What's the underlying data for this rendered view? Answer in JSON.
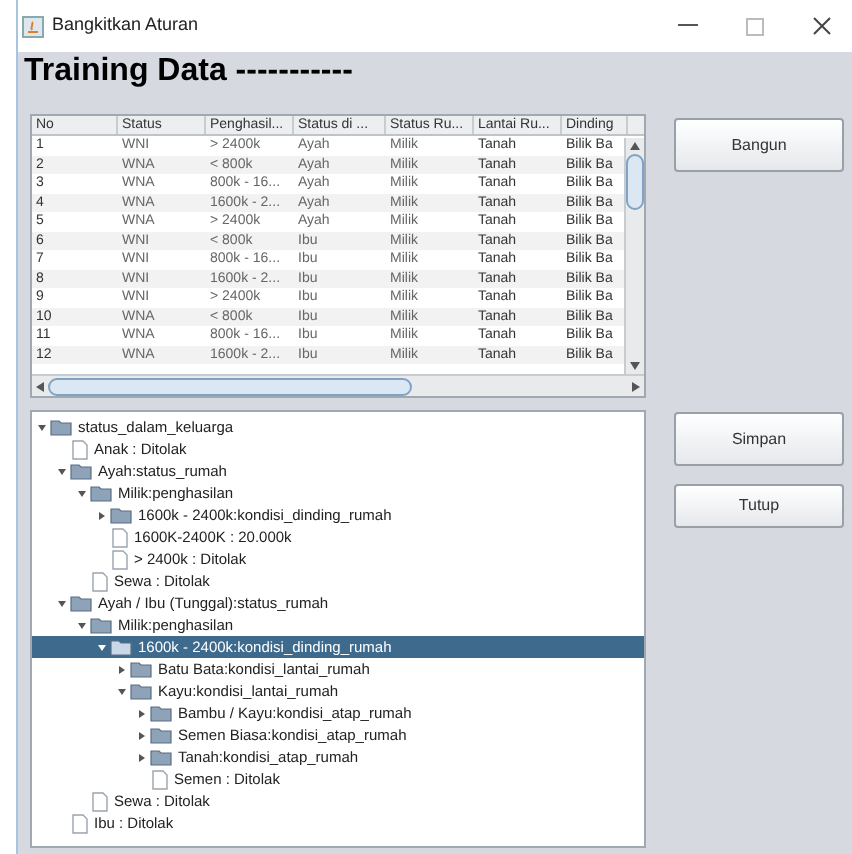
{
  "window": {
    "title": "Bangkitkan Aturan"
  },
  "heading": "Training  Data -----------",
  "table": {
    "columns": [
      "No",
      "Status",
      "Penghasil...",
      "Status di ...",
      "Status Ru...",
      "Lantai Ru...",
      "Dinding"
    ],
    "rows": [
      [
        "1",
        "WNI",
        "> 2400k",
        "Ayah",
        "Milik",
        "Tanah",
        "Bilik Ba"
      ],
      [
        "2",
        "WNA",
        "< 800k",
        "Ayah",
        "Milik",
        "Tanah",
        "Bilik Ba"
      ],
      [
        "3",
        "WNA",
        "800k - 16...",
        "Ayah",
        "Milik",
        "Tanah",
        "Bilik Ba"
      ],
      [
        "4",
        "WNA",
        "1600k - 2...",
        "Ayah",
        "Milik",
        "Tanah",
        "Bilik Ba"
      ],
      [
        "5",
        "WNA",
        "> 2400k",
        "Ayah",
        "Milik",
        "Tanah",
        "Bilik Ba"
      ],
      [
        "6",
        "WNI",
        "< 800k",
        "Ibu",
        "Milik",
        "Tanah",
        "Bilik Ba"
      ],
      [
        "7",
        "WNI",
        "800k - 16...",
        "Ibu",
        "Milik",
        "Tanah",
        "Bilik Ba"
      ],
      [
        "8",
        "WNI",
        "1600k - 2...",
        "Ibu",
        "Milik",
        "Tanah",
        "Bilik Ba"
      ],
      [
        "9",
        "WNI",
        "> 2400k",
        "Ibu",
        "Milik",
        "Tanah",
        "Bilik Ba"
      ],
      [
        "10",
        "WNA",
        "< 800k",
        "Ibu",
        "Milik",
        "Tanah",
        "Bilik Ba"
      ],
      [
        "11",
        "WNA",
        "800k - 16...",
        "Ibu",
        "Milik",
        "Tanah",
        "Bilik Ba"
      ],
      [
        "12",
        "WNA",
        "1600k - 2...",
        "Ibu",
        "Milik",
        "Tanah",
        "Bilik Ba"
      ]
    ]
  },
  "tree": [
    {
      "kind": "folder",
      "label": "status_dalam_keluarga",
      "expanded": true,
      "selected": false,
      "children": [
        {
          "kind": "leaf",
          "label": "Anak : Ditolak",
          "selected": false
        },
        {
          "kind": "folder",
          "label": "Ayah:status_rumah",
          "expanded": true,
          "selected": false,
          "children": [
            {
              "kind": "folder",
              "label": "Milik:penghasilan",
              "expanded": true,
              "selected": false,
              "children": [
                {
                  "kind": "folder",
                  "label": "1600k - 2400k:kondisi_dinding_rumah",
                  "expanded": false,
                  "selected": false
                },
                {
                  "kind": "leaf",
                  "label": "1600K-2400K : 20.000k",
                  "selected": false
                },
                {
                  "kind": "leaf",
                  "label": "> 2400k : Ditolak",
                  "selected": false
                }
              ]
            },
            {
              "kind": "leaf",
              "label": "Sewa : Ditolak",
              "selected": false
            }
          ]
        },
        {
          "kind": "folder",
          "label": "Ayah / Ibu (Tunggal):status_rumah",
          "expanded": true,
          "selected": false,
          "children": [
            {
              "kind": "folder",
              "label": "Milik:penghasilan",
              "expanded": true,
              "selected": false,
              "children": [
                {
                  "kind": "folder",
                  "label": "1600k - 2400k:kondisi_dinding_rumah",
                  "expanded": true,
                  "selected": true,
                  "children": [
                    {
                      "kind": "folder",
                      "label": "Batu Bata:kondisi_lantai_rumah",
                      "expanded": false,
                      "selected": false
                    },
                    {
                      "kind": "folder",
                      "label": "Kayu:kondisi_lantai_rumah",
                      "expanded": true,
                      "selected": false,
                      "children": [
                        {
                          "kind": "folder",
                          "label": "Bambu / Kayu:kondisi_atap_rumah",
                          "expanded": false,
                          "selected": false
                        },
                        {
                          "kind": "folder",
                          "label": "Semen Biasa:kondisi_atap_rumah",
                          "expanded": false,
                          "selected": false
                        },
                        {
                          "kind": "folder",
                          "label": "Tanah:kondisi_atap_rumah",
                          "expanded": false,
                          "selected": false
                        },
                        {
                          "kind": "leaf",
                          "label": "Semen : Ditolak",
                          "selected": false
                        }
                      ]
                    }
                  ]
                }
              ]
            },
            {
              "kind": "leaf",
              "label": "Sewa : Ditolak",
              "selected": false
            }
          ]
        },
        {
          "kind": "leaf",
          "label": "Ibu : Ditolak",
          "selected": false
        }
      ]
    }
  ],
  "buttons": [
    "Bangun",
    "Simpan",
    "Tutup"
  ]
}
